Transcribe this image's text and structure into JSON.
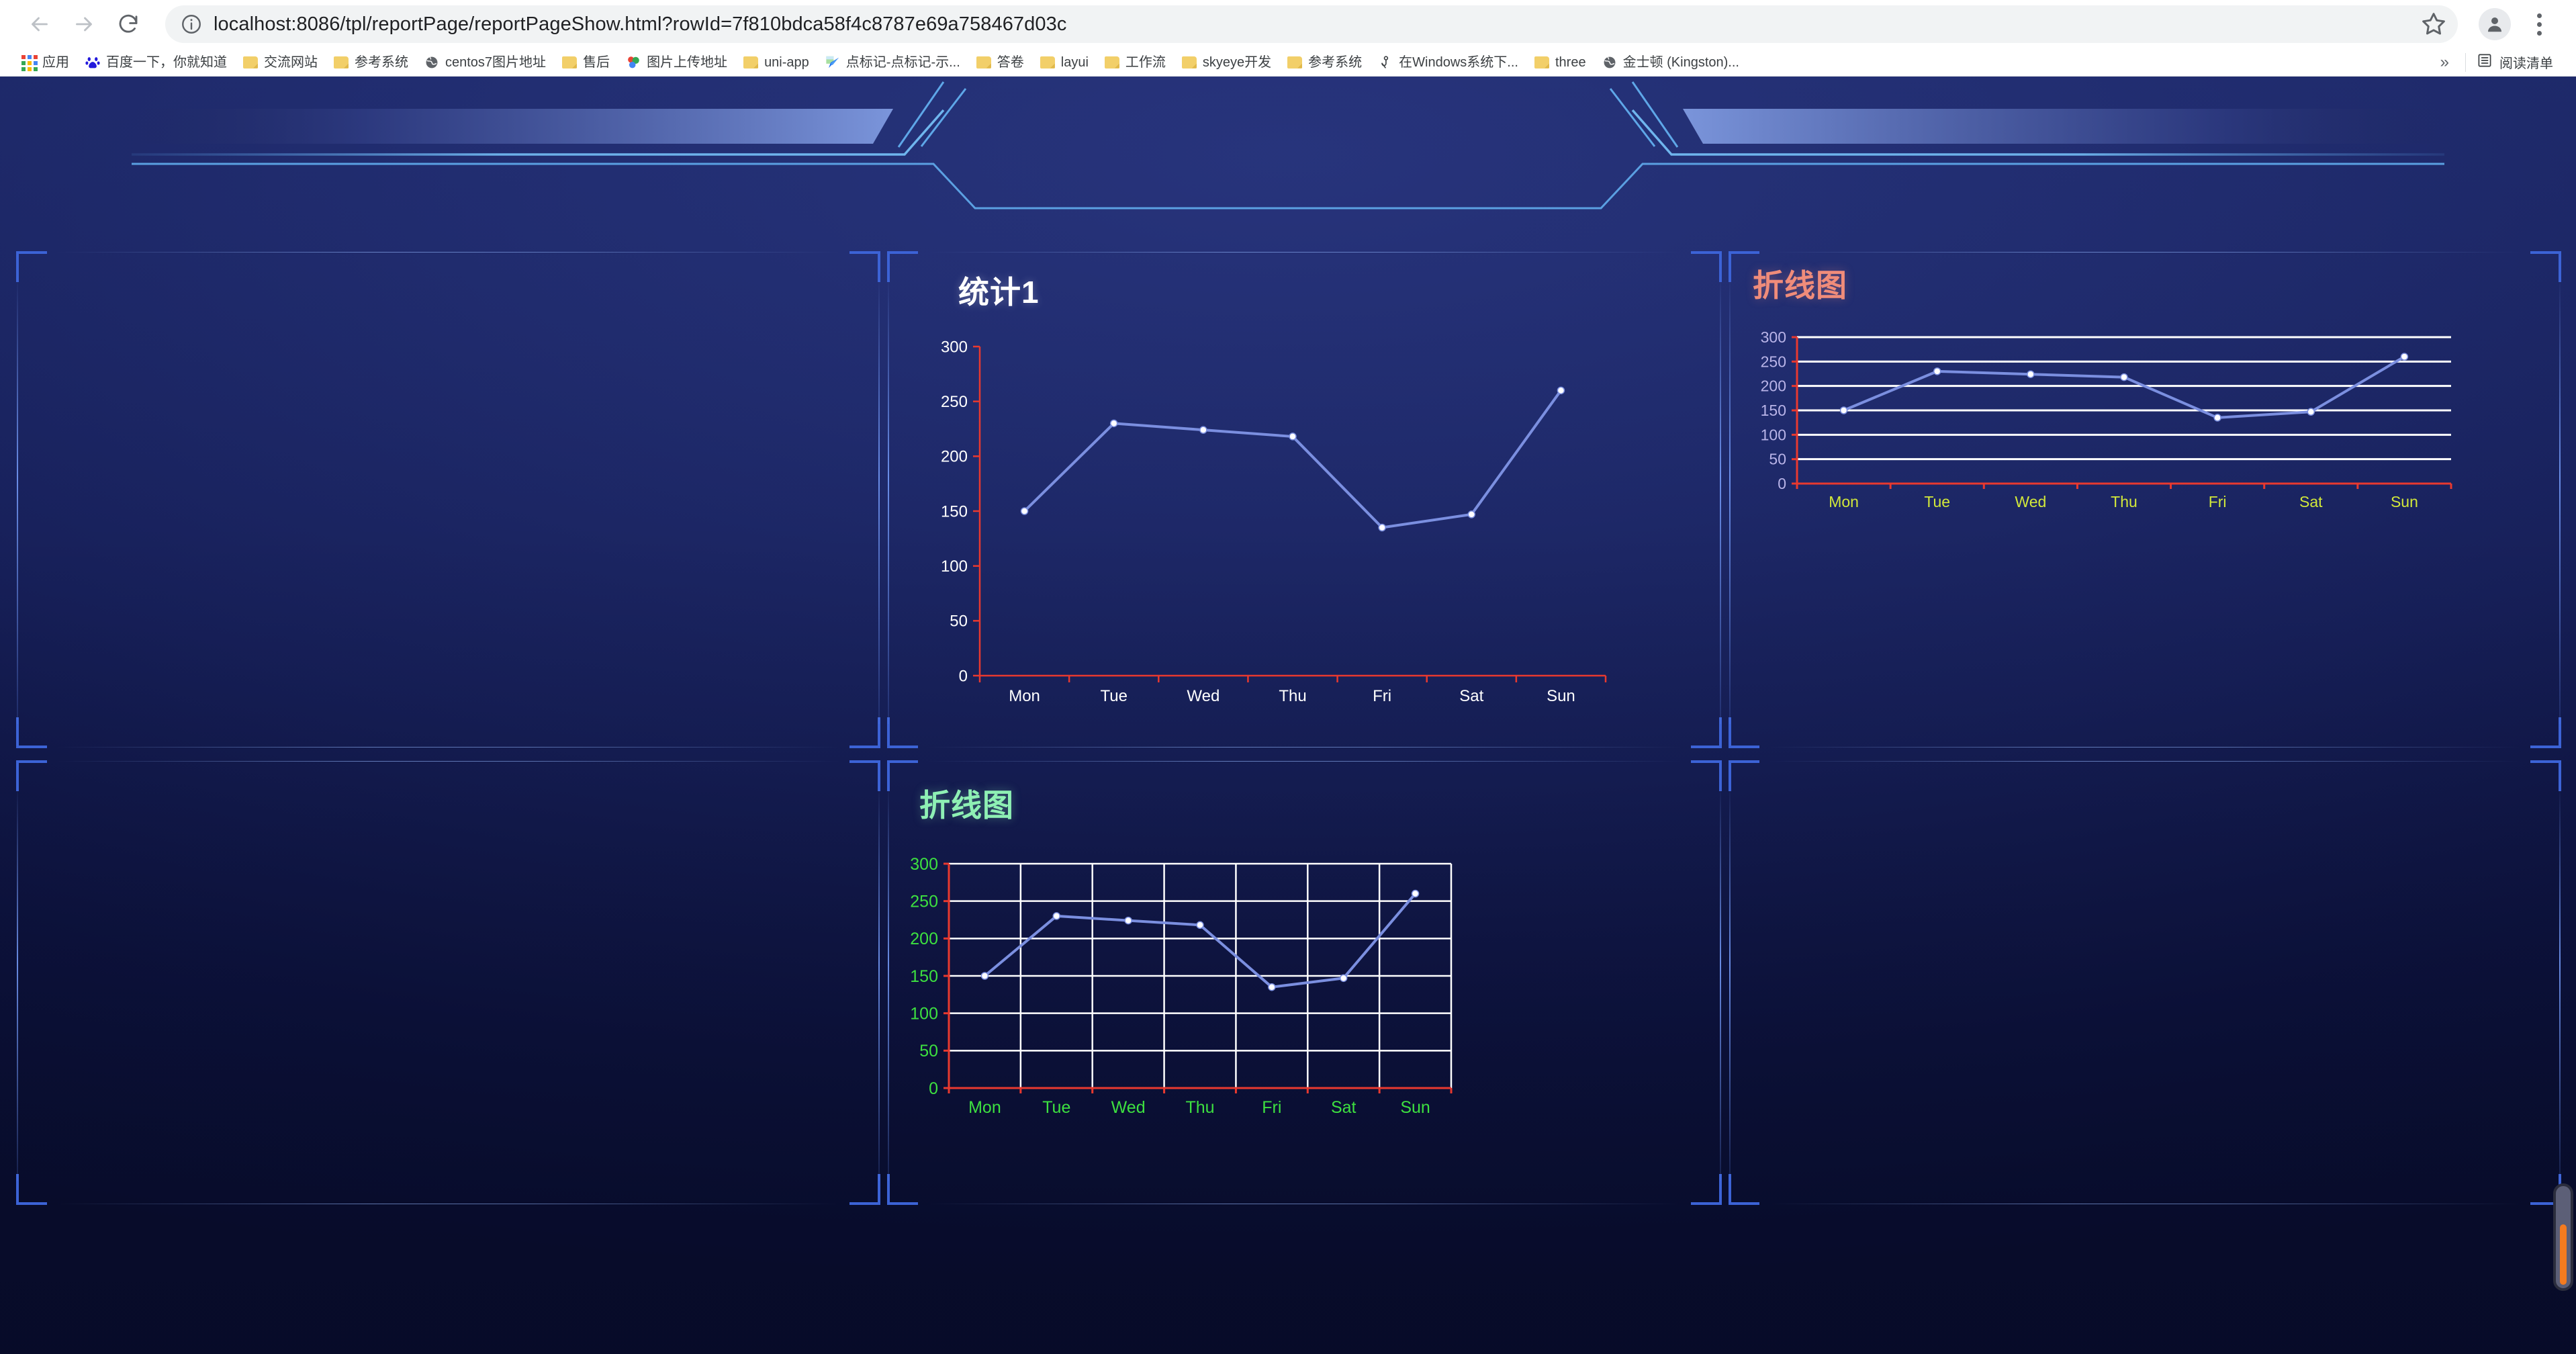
{
  "browser": {
    "back_icon": "back-arrow-icon",
    "forward_icon": "forward-arrow-icon",
    "reload_icon": "reload-icon",
    "url_prefix": "localhost",
    "url_rest": ":8086/tpl/reportPage/reportPageShow.html?rowId=7f810bdca58f4c8787e69a758467d03c",
    "url_full": "localhost:8086/tpl/reportPage/reportPageShow.html?rowId=7f810bdca58f4c8787e69a758467d03c",
    "star_icon": "bookmark-star-icon",
    "profile_icon": "profile-avatar-icon",
    "menu_icon": "three-dot-menu-icon",
    "info_icon": "site-info-icon"
  },
  "bookmarks": {
    "items": [
      {
        "label": "应用",
        "icon": "apps-grid-icon"
      },
      {
        "label": "百度一下，你就知道",
        "icon": "baidu-icon"
      },
      {
        "label": "交流网站",
        "icon": "folder-icon"
      },
      {
        "label": "参考系统",
        "icon": "folder-icon"
      },
      {
        "label": "centos7图片地址",
        "icon": "globe-icon"
      },
      {
        "label": "售后",
        "icon": "folder-icon"
      },
      {
        "label": "图片上传地址",
        "icon": "balloons-icon"
      },
      {
        "label": "uni-app",
        "icon": "folder-icon"
      },
      {
        "label": "点标记-点标记-示...",
        "icon": "amap-icon"
      },
      {
        "label": "答卷",
        "icon": "folder-icon"
      },
      {
        "label": "layui",
        "icon": "folder-icon"
      },
      {
        "label": "工作流",
        "icon": "folder-icon"
      },
      {
        "label": "skyeye开发",
        "icon": "folder-icon"
      },
      {
        "label": "参考系统",
        "icon": "folder-icon"
      },
      {
        "label": "在Windows系统下...",
        "icon": "person-icon"
      },
      {
        "label": "three",
        "icon": "folder-icon"
      },
      {
        "label": "金士顿 (Kingston)...",
        "icon": "globe-icon"
      }
    ],
    "overflow_label": "»",
    "reading_list": {
      "label": "阅读清单",
      "icon": "reading-list-icon"
    }
  },
  "dashboard": {
    "colors": {
      "background_top": "#27337a",
      "background_bottom": "#0a0f33",
      "panel_bracket": "#3c63d6",
      "series_line": "#7b8fe0",
      "axis_red": "#e8392f",
      "grid_white": "#ffffff"
    },
    "scrollbar": {
      "name": "page-scrollbar",
      "thumb_color": "#f47b20"
    }
  },
  "chart_data": [
    {
      "id": "chart-tongji1",
      "type": "line",
      "title": "统计1",
      "title_color": "#ffffff",
      "categories": [
        "Mon",
        "Tue",
        "Wed",
        "Thu",
        "Fri",
        "Sat",
        "Sun"
      ],
      "values": [
        150,
        230,
        224,
        218,
        135,
        147,
        260
      ],
      "series": [
        {
          "name": "统计1",
          "values": [
            150,
            230,
            224,
            218,
            135,
            147,
            260
          ]
        }
      ],
      "yticks": [
        0,
        50,
        100,
        150,
        200,
        250,
        300
      ],
      "ylim": [
        0,
        300
      ],
      "xlabel": "",
      "ylabel": "",
      "grid": "none",
      "axis_color": "#e8392f",
      "tick_label_color": "#ffffff",
      "x_label_color": "#ffffff",
      "line_color": "#7b8fe0",
      "point_color": "#ffffff",
      "legend": "none"
    },
    {
      "id": "chart-zhexiantu-right",
      "type": "line",
      "title": "折线图",
      "title_color": "#f08c7a",
      "categories": [
        "Mon",
        "Tue",
        "Wed",
        "Thu",
        "Fri",
        "Sat",
        "Sun"
      ],
      "values": [
        150,
        230,
        224,
        218,
        135,
        147,
        260
      ],
      "series": [
        {
          "name": "折线图",
          "values": [
            150,
            230,
            224,
            218,
            135,
            147,
            260
          ]
        }
      ],
      "yticks": [
        0,
        50,
        100,
        150,
        200,
        250,
        300
      ],
      "ylim": [
        0,
        300
      ],
      "xlabel": "",
      "ylabel": "",
      "grid": "horizontal",
      "axis_color": "#e8392f",
      "tick_label_color": "#b9b4e8",
      "x_label_color": "#d2e83a",
      "line_color": "#7b8fe0",
      "point_color": "#ffffff",
      "legend": "none"
    },
    {
      "id": "chart-zhexiantu-bottom",
      "type": "line",
      "title": "折线图",
      "title_color": "#8ef0b4",
      "categories": [
        "Mon",
        "Tue",
        "Wed",
        "Thu",
        "Fri",
        "Sat",
        "Sun"
      ],
      "values": [
        150,
        230,
        224,
        218,
        135,
        147,
        260
      ],
      "series": [
        {
          "name": "折线图",
          "values": [
            150,
            230,
            224,
            218,
            135,
            147,
            260
          ]
        }
      ],
      "yticks": [
        0,
        50,
        100,
        150,
        200,
        250,
        300
      ],
      "ylim": [
        0,
        300
      ],
      "xlabel": "",
      "ylabel": "",
      "grid": "both",
      "axis_color": "#e8392f",
      "tick_label_color": "#3de040",
      "x_label_color": "#3de040",
      "line_color": "#7b8fe0",
      "point_color": "#ffffff",
      "legend": "none"
    }
  ]
}
